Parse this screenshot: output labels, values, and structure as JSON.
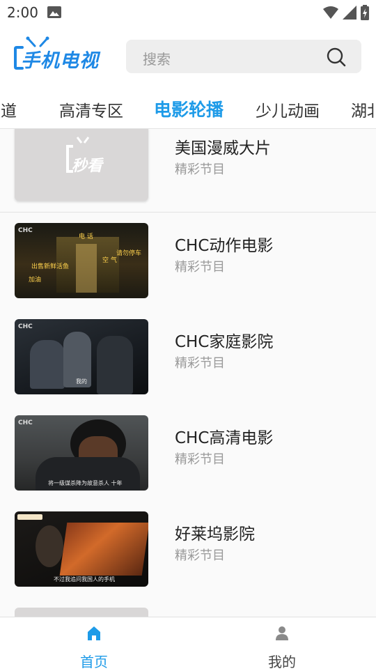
{
  "status_bar": {
    "time": "2:00"
  },
  "app": {
    "logo_text": "手机电视",
    "brand_color": "#1e88e5"
  },
  "search": {
    "placeholder": "搜索"
  },
  "tabs": [
    {
      "label": "频道"
    },
    {
      "label": "高清专区"
    },
    {
      "label": "电影轮播",
      "active": true
    },
    {
      "label": "少儿动画"
    },
    {
      "label": "湖北"
    }
  ],
  "placeholder_logo_text": "秒看",
  "channels": [
    {
      "name": "美国漫威大片",
      "subtitle": "精彩节目",
      "thumb": "placeholder"
    },
    {
      "name": "CHC动作电影",
      "subtitle": "精彩节目",
      "thumb": "night-scene",
      "thumb_texts": {
        "badge": "CHC",
        "a": "电 话",
        "b": "请勿停车",
        "c": "空 气",
        "d": "出售新鲜活鱼",
        "e": "加油"
      }
    },
    {
      "name": "CHC家庭影院",
      "subtitle": "精彩节目",
      "thumb": "dark-room",
      "thumb_texts": {
        "badge": "CHC",
        "caption": "我的"
      }
    },
    {
      "name": "CHC高清电影",
      "subtitle": "精彩节目",
      "thumb": "portrait",
      "thumb_texts": {
        "badge": "CHC",
        "caption": "将一级谋杀降为故意杀人 十年"
      }
    },
    {
      "name": "好莱坞影院",
      "subtitle": "精彩节目",
      "thumb": "cockpit",
      "thumb_texts": {
        "caption": "不过我追问我国人的手机"
      }
    }
  ],
  "bottom_nav": [
    {
      "label": "首页",
      "icon": "home-icon",
      "active": true
    },
    {
      "label": "我的",
      "icon": "person-icon",
      "active": false
    }
  ],
  "colors": {
    "accent": "#1e9be8",
    "inactive": "#444444"
  }
}
